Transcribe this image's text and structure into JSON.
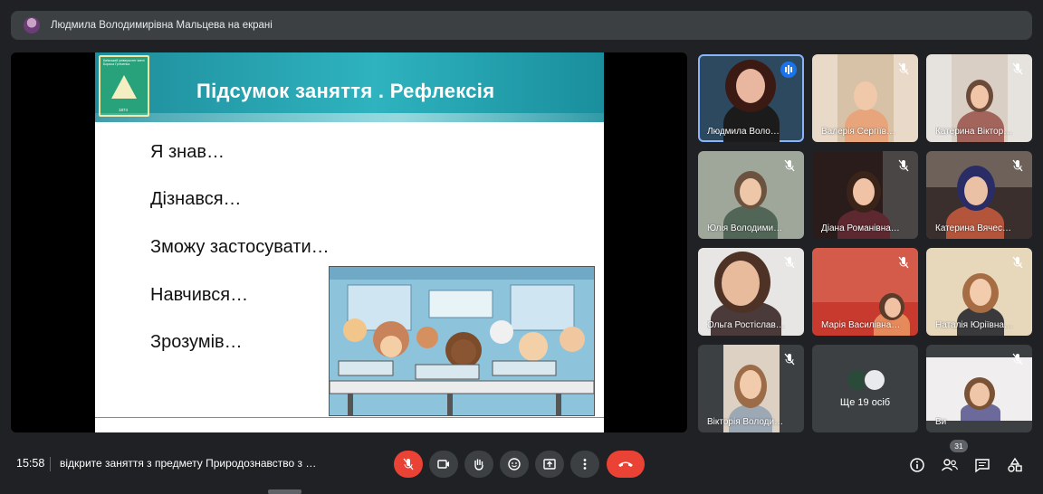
{
  "presenter_bar": {
    "title": "Людмила Володимирівна Мальцева на екрані"
  },
  "slide": {
    "title": "Підсумок заняття . Рефлексія",
    "logo_text": "Київський університет імені Бориса Грінченка",
    "logo_year": "1874",
    "lines": [
      "Я знав…",
      "Дізнався…",
      "Зможу застосувати…",
      "Навчився…",
      "Зрозумів…"
    ]
  },
  "participants": [
    {
      "name": "Людмила Воло…",
      "state": "speaking"
    },
    {
      "name": "Валерія Сергіїв…",
      "state": "muted"
    },
    {
      "name": "Катерина Віктор…",
      "state": "muted"
    },
    {
      "name": "Юлія Володими…",
      "state": "muted"
    },
    {
      "name": "Діана Романівна…",
      "state": "muted"
    },
    {
      "name": "Катерина Вячес…",
      "state": "muted"
    },
    {
      "name": "Ольга Ростіслав…",
      "state": "muted"
    },
    {
      "name": "Марія Василівна…",
      "state": "muted"
    },
    {
      "name": "Наталія Юріївна…",
      "state": "muted"
    },
    {
      "name": "Вікторія Володи…",
      "state": "muted"
    },
    {
      "name": "Ще 19 осіб",
      "state": "overflow"
    },
    {
      "name": "Ви",
      "state": "muted"
    }
  ],
  "bottombar": {
    "time": "15:58",
    "meeting_title": "відкрите заняття з предмету Природознавство з …",
    "people_count": "31"
  },
  "icons": {
    "mic": "mic-off-icon",
    "camera": "camera-icon",
    "hand": "raise-hand-icon",
    "emoji": "emoji-icon",
    "present": "present-screen-icon",
    "more": "more-vert-icon",
    "end": "end-call-icon",
    "info": "info-icon",
    "people": "people-icon",
    "chat": "chat-icon",
    "activities": "activities-icon"
  },
  "colors": {
    "end_call": "#ea4335",
    "speaking": "#1a73e8",
    "background": "#202124"
  }
}
